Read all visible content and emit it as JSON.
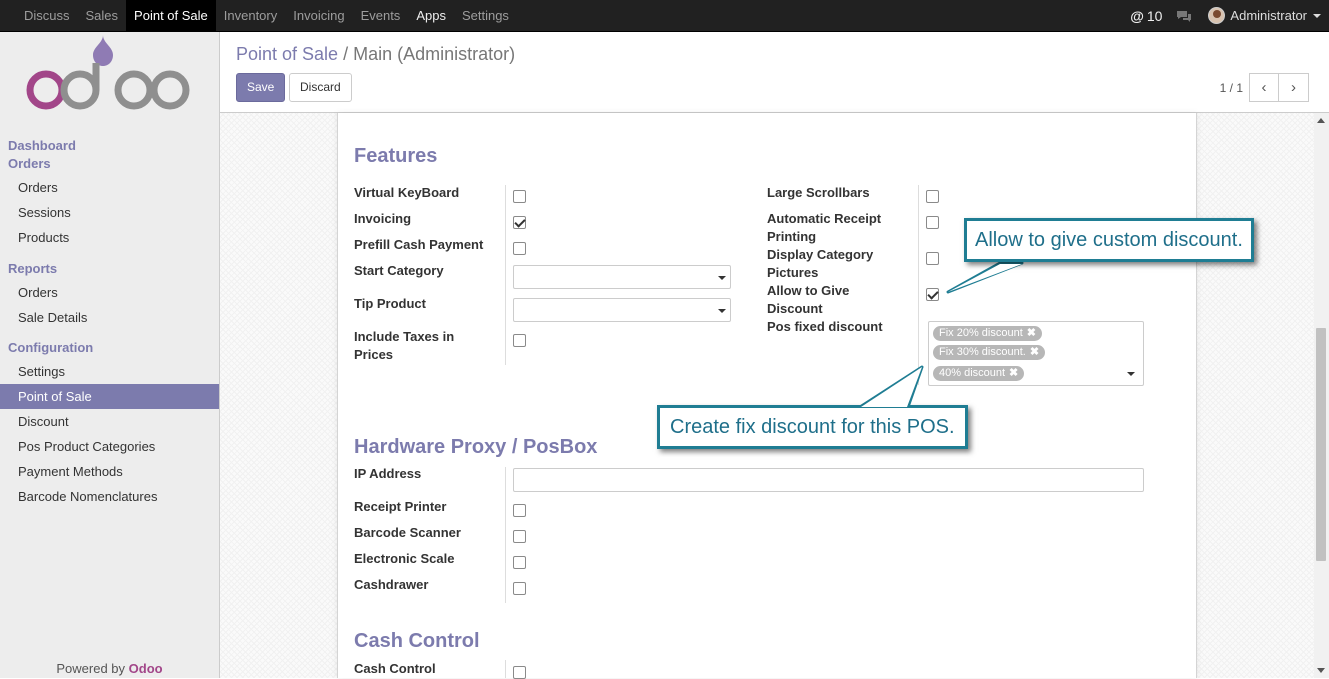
{
  "topbar": {
    "menu": [
      "Discuss",
      "Sales",
      "Point of Sale",
      "Inventory",
      "Invoicing",
      "Events",
      "Apps",
      "Settings"
    ],
    "active_index": 2,
    "mentions_count": "10",
    "user_name": "Administrator"
  },
  "sidebar": {
    "sections": [
      {
        "heading": "Dashboard",
        "items": []
      },
      {
        "heading": "Orders",
        "items": [
          "Orders",
          "Sessions",
          "Products"
        ]
      },
      {
        "heading": "Reports",
        "items": [
          "Orders",
          "Sale Details"
        ]
      },
      {
        "heading": "Configuration",
        "items": [
          "Settings",
          "Point of Sale",
          "Discount",
          "Pos Product Categories",
          "Payment Methods",
          "Barcode Nomenclatures"
        ]
      }
    ],
    "active_item": "Point of Sale",
    "powered_prefix": "Powered by",
    "powered_brand": "Odoo"
  },
  "control_panel": {
    "breadcrumb_parent": "Point of Sale",
    "breadcrumb_sep": "/",
    "breadcrumb_current": "Main (Administrator)",
    "save_label": "Save",
    "discard_label": "Discard",
    "pager_value": "1 / 1"
  },
  "features": {
    "title": "Features",
    "left": [
      {
        "label": "Virtual KeyBoard",
        "type": "checkbox",
        "checked": false
      },
      {
        "label": "Invoicing",
        "type": "checkbox",
        "checked": true
      },
      {
        "label": "Prefill Cash Payment",
        "type": "checkbox",
        "checked": false
      },
      {
        "label": "Start Category",
        "type": "select",
        "value": ""
      },
      {
        "label": "Tip Product",
        "type": "select",
        "value": ""
      },
      {
        "label": "Include Taxes in Prices",
        "type": "checkbox",
        "checked": false
      }
    ],
    "right": [
      {
        "label": "Large Scrollbars",
        "type": "checkbox",
        "checked": false
      },
      {
        "label": "Automatic Receipt Printing",
        "type": "checkbox",
        "checked": false
      },
      {
        "label": "Display Category Pictures",
        "type": "checkbox",
        "checked": false
      },
      {
        "label": "Allow to Give Discount",
        "type": "checkbox",
        "checked": true
      },
      {
        "label": "Pos fixed discount",
        "type": "tags",
        "tags": [
          "Fix 20% discount",
          "Fix 30% discount.",
          "40% discount"
        ]
      }
    ]
  },
  "hardware": {
    "title": "Hardware Proxy / PosBox",
    "fields": [
      {
        "label": "IP Address",
        "type": "text",
        "value": ""
      },
      {
        "label": "Receipt Printer",
        "type": "checkbox",
        "checked": false
      },
      {
        "label": "Barcode Scanner",
        "type": "checkbox",
        "checked": false
      },
      {
        "label": "Electronic Scale",
        "type": "checkbox",
        "checked": false
      },
      {
        "label": "Cashdrawer",
        "type": "checkbox",
        "checked": false
      }
    ]
  },
  "cash_control": {
    "title": "Cash Control",
    "fields": [
      {
        "label": "Cash Control",
        "type": "checkbox",
        "checked": false
      }
    ]
  },
  "callouts": {
    "discount": "Allow to give custom discount.",
    "fixed": "Create fix discount for this POS."
  },
  "colors": {
    "brand": "#7c7bad",
    "topbar": "#212121",
    "callout_border": "#1f7d93",
    "odoo_purple": "#a24689"
  }
}
